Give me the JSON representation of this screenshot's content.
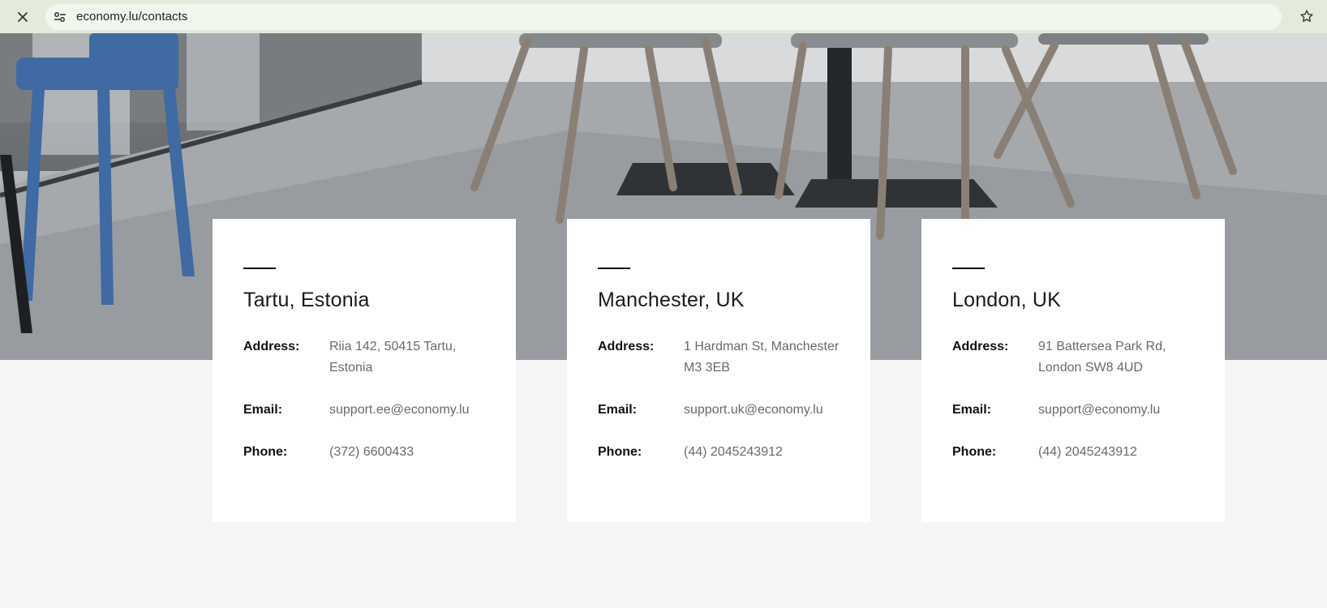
{
  "browser": {
    "url": "economy.lu/contacts",
    "close_icon": "close-icon",
    "site_info_icon": "tune-icon",
    "bookmark_icon": "star-outline-icon"
  },
  "hero": {
    "image": "cafe-interior-photo",
    "colors": {
      "floor": "#9da1a4",
      "chair_blue": "#3f6aa3",
      "chair_legs": "#8a7f75"
    }
  },
  "offices": [
    {
      "city": "Tartu, Estonia",
      "address_label": "Address:",
      "address": "Riia 142, 50415 Tartu, Estonia",
      "email_label": "Email:",
      "email": "support.ee@economy.lu",
      "phone_label": "Phone:",
      "phone": "(372) 6600433"
    },
    {
      "city": "Manchester, UK",
      "address_label": "Address:",
      "address": "1 Hardman St, Manchester M3 3EB",
      "email_label": "Email:",
      "email": "support.uk@economy.lu",
      "phone_label": "Phone:",
      "phone": "(44) 2045243912"
    },
    {
      "city": "London, UK",
      "address_label": "Address:",
      "address": "91 Battersea Park Rd, London SW8 4UD",
      "email_label": "Email:",
      "email": "support@economy.lu",
      "phone_label": "Phone:",
      "phone": "(44) 2045243912"
    }
  ]
}
